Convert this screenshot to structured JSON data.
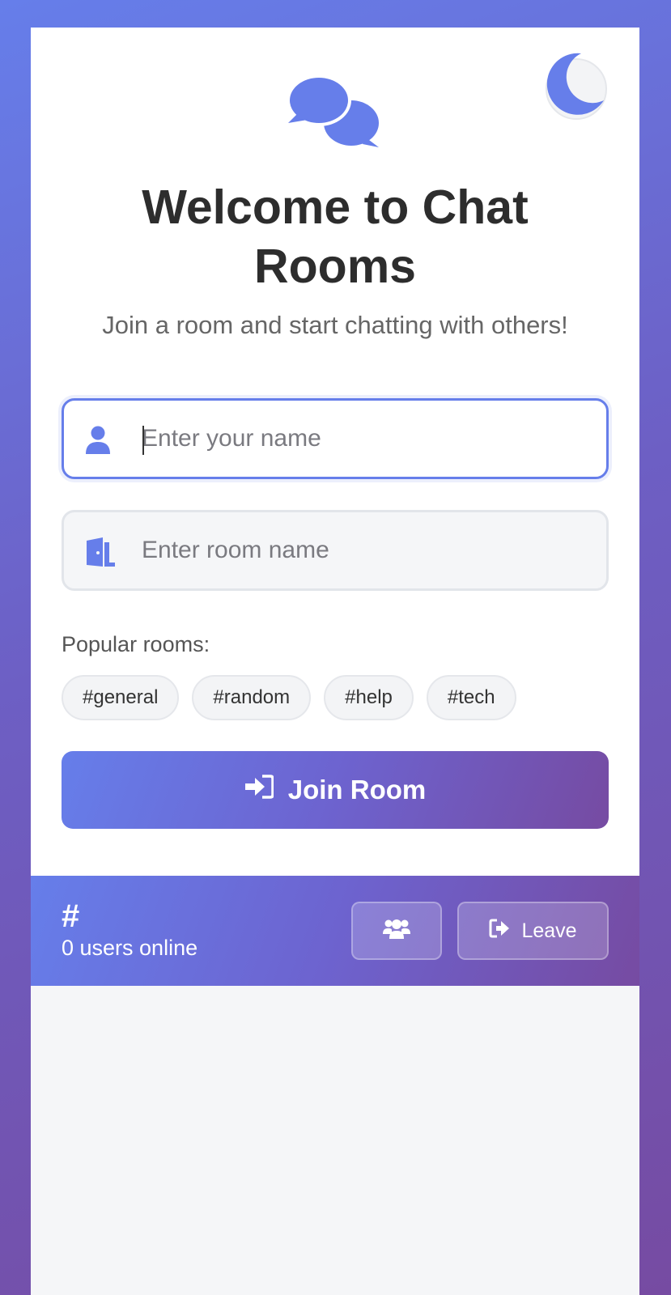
{
  "colors": {
    "accent": "#667eea",
    "accent_end": "#764ba2",
    "title": "#2d2d2d",
    "subtitle": "#666666",
    "field_bg": "#f5f6f8"
  },
  "theme_toggle": {
    "icon": "moon-icon"
  },
  "header": {
    "logo_icon": "chat-bubbles-icon",
    "title": "Welcome to Chat Rooms",
    "subtitle": "Join a room and start chatting with others!"
  },
  "form": {
    "name_field": {
      "icon": "user-icon",
      "placeholder": "Enter your name",
      "value": ""
    },
    "room_field": {
      "icon": "door-icon",
      "placeholder": "Enter room name",
      "value": ""
    },
    "popular_label": "Popular rooms:",
    "popular_rooms": [
      "#general",
      "#random",
      "#help",
      "#tech"
    ],
    "join_button": {
      "icon": "sign-in-icon",
      "label": "Join Room"
    }
  },
  "room_header": {
    "room_name": "#",
    "users_online": "0 users online",
    "users_button": {
      "icon": "users-icon"
    },
    "leave_button": {
      "icon": "sign-out-icon",
      "label": "Leave"
    }
  }
}
